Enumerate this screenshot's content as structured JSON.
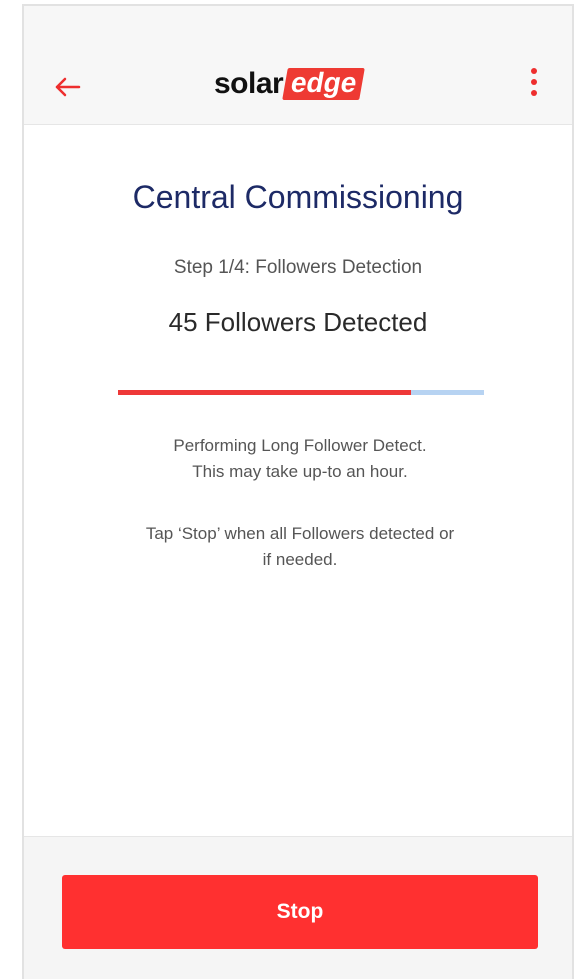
{
  "header": {
    "logo_part1": "solar",
    "logo_part2": "edge"
  },
  "main": {
    "title": "Central Commissioning",
    "step": "Step 1/4: Followers Detection",
    "detected": "45 Followers Detected",
    "progress_fraction": 0.8,
    "message_line1": "Performing Long Follower Detect.",
    "message_line2": "This may take up-to an hour.",
    "hint_line1": "Tap ‘Stop’ when all Followers detected or",
    "hint_line2": "if needed."
  },
  "footer": {
    "stop_label": "Stop"
  },
  "colors": {
    "accent": "#ff3030",
    "title": "#1d2a66",
    "progress_track": "#b7d3f2"
  },
  "icons": {
    "back": "arrow-left-icon",
    "menu": "more-vertical-icon"
  }
}
